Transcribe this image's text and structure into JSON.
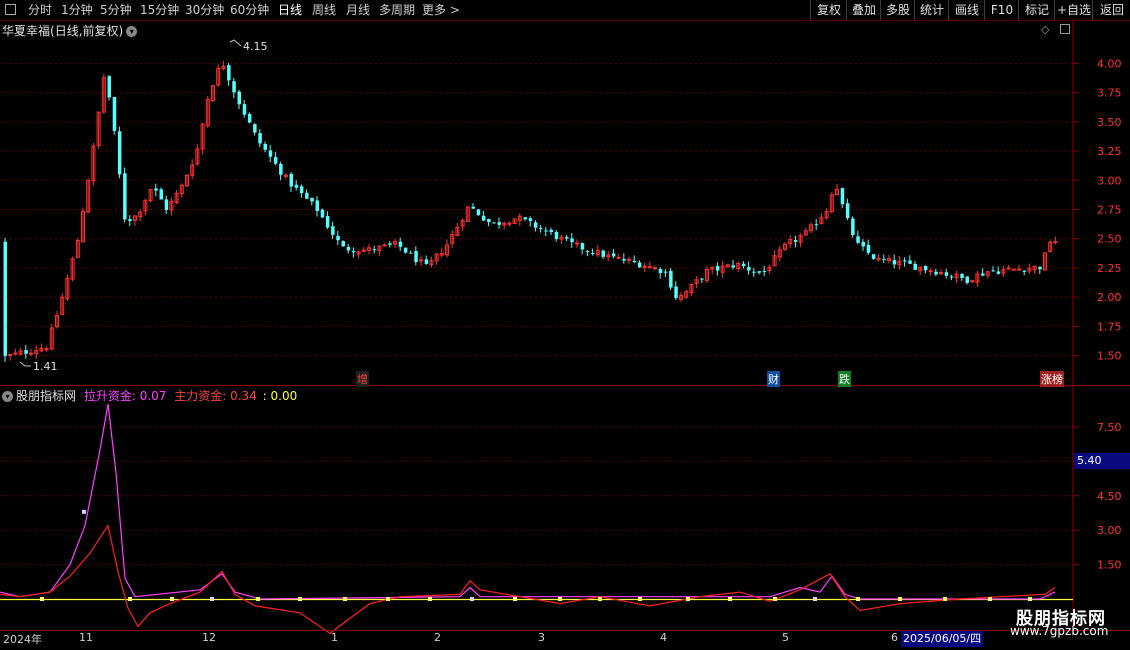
{
  "toolbar": {
    "period_tabs": [
      "分时",
      "1分钟",
      "5分钟",
      "15分钟",
      "30分钟",
      "60分钟",
      "日线",
      "周线",
      "月线",
      "多周期",
      "更多 >"
    ],
    "active_tab": "日线",
    "right_buttons": [
      "复权",
      "叠加",
      "多股",
      "统计",
      "画线",
      "F10",
      "标记",
      "+自选",
      "返回"
    ]
  },
  "stock": {
    "name": "华夏幸福",
    "mode": "(日线,前复权)",
    "high_label": "4.15",
    "low_label": "1.41"
  },
  "main_axis": {
    "ticks": [
      "4.00",
      "3.75",
      "3.50",
      "3.25",
      "3.00",
      "2.75",
      "2.50",
      "2.25",
      "2.00",
      "1.75",
      "1.50"
    ]
  },
  "markers": [
    {
      "label": "增",
      "color": "#ff4040"
    },
    {
      "label": "财",
      "color": "#40a0ff"
    },
    {
      "label": "跌",
      "color": "#40e040"
    },
    {
      "label": "涨榜",
      "color": "#ff4040"
    }
  ],
  "indicator": {
    "name": "股朋指标网",
    "pull_label": "拉升资金: 0.07",
    "main_label": "主力资金: 0.34",
    "zero_label": ": 0.00",
    "axis_ticks": [
      "7.50",
      "6.00",
      "4.50",
      "3.00",
      "1.50"
    ],
    "highlight_value": "5.40",
    "colors": {
      "pull": "#ff40ff",
      "main": "#ff2020",
      "zero": "#ffff40"
    }
  },
  "date_axis": {
    "labels": [
      "2024年",
      "11",
      "12",
      "1",
      "2",
      "3",
      "4",
      "5",
      "6"
    ],
    "current_date": "2025/06/05/四"
  },
  "watermark": {
    "title": "股朋指标网",
    "url": "www.7gpzb.com"
  },
  "chart_data": {
    "type": "candlestick",
    "title": "华夏幸福(日线,前复权)",
    "ylim": [
      1.36,
      4.2
    ],
    "y_ticks": [
      1.5,
      1.75,
      2.0,
      2.25,
      2.5,
      2.75,
      3.0,
      3.25,
      3.5,
      3.75,
      4.0
    ],
    "x_labels": [
      "2024年",
      "11",
      "12",
      "1",
      "2",
      "3",
      "4",
      "5",
      "6"
    ],
    "high": 4.15,
    "low": 1.41,
    "series": [
      {
        "name": "拉升资金",
        "last": 0.07
      },
      {
        "name": "主力资金",
        "last": 0.34
      }
    ],
    "indicator_ylim": [
      0,
      8.5
    ],
    "indicator_ticks": [
      1.5,
      3.0,
      4.5,
      6.0,
      7.5
    ]
  }
}
